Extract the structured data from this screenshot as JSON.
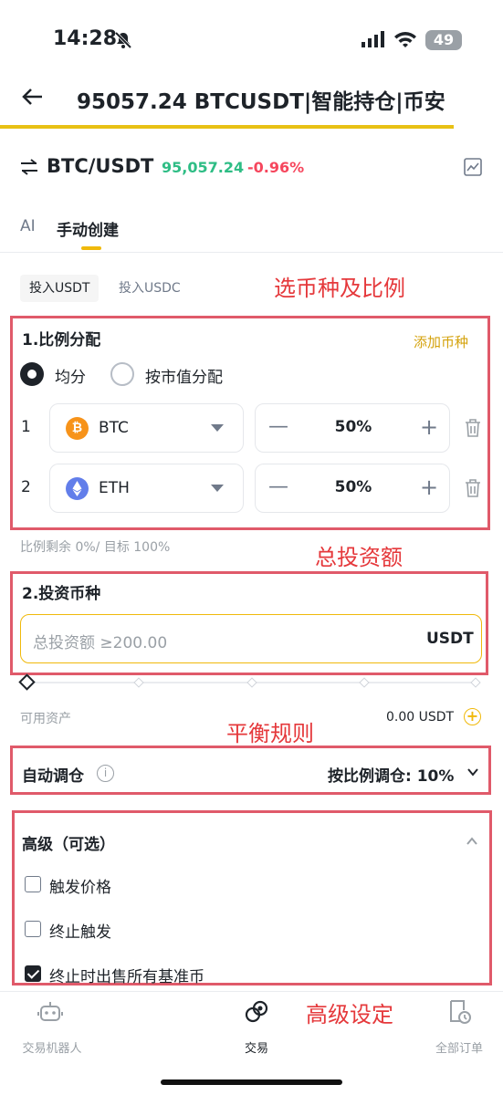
{
  "status_bar": {
    "time": "14:28",
    "battery": "49"
  },
  "header": {
    "title": "95057.24 BTCUSDT|智能持仓|币安"
  },
  "pair": {
    "name": "BTC/USDT",
    "price": "95,057.24",
    "change": "-0.96%"
  },
  "mode_tabs": [
    {
      "label": "AI"
    },
    {
      "label": "手动创建"
    }
  ],
  "currency_tabs": [
    {
      "label": "投入USDT"
    },
    {
      "label": "投入USDC"
    }
  ],
  "annotations": {
    "select_coin": "选币种及比例",
    "total_amount": "总投资额",
    "rebalance": "平衡规则",
    "advanced": "高级设定"
  },
  "allocation": {
    "title": "1.比例分配",
    "add_coin": "添加币种",
    "options": [
      {
        "label": "均分",
        "selected": true
      },
      {
        "label": "按市值分配",
        "selected": false
      }
    ],
    "rows": [
      {
        "index": "1",
        "coin": "BTC",
        "icon": "btc-icon",
        "color": "#f7931a",
        "percent": "50%"
      },
      {
        "index": "2",
        "coin": "ETH",
        "icon": "eth-icon",
        "color": "#627eea",
        "percent": "50%"
      }
    ],
    "note": "比例剩余 0%/ 目标 100%"
  },
  "investment": {
    "title": "2.投资币种",
    "placeholder": "总投资额  ≥200.00",
    "unit": "USDT",
    "available_label": "可用资产",
    "available_value": "0.00 USDT"
  },
  "rebalance": {
    "label": "自动调仓",
    "value": "按比例调仓: 10%"
  },
  "advanced": {
    "title": "高级（可选）",
    "options": [
      {
        "label": "触发价格",
        "checked": false
      },
      {
        "label": "终止触发",
        "checked": false
      },
      {
        "label": "终止时出售所有基准币",
        "checked": true
      }
    ]
  },
  "bottom_nav": [
    {
      "label": "交易机器人",
      "icon": "robot-icon",
      "active": false
    },
    {
      "label": "交易",
      "icon": "trade-icon",
      "active": true
    },
    {
      "label": "全部订单",
      "icon": "orders-icon",
      "active": false
    }
  ],
  "colors": {
    "accent": "#f0b90b",
    "up": "#2ebd85",
    "down": "#f6465d",
    "annotation": "#e5383b"
  }
}
